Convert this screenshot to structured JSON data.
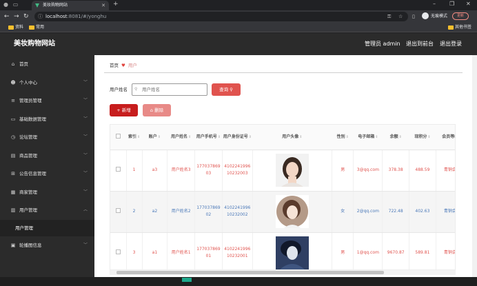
{
  "browser": {
    "tab_title": "美妆购物网站",
    "url_host": "localhost",
    "url_path": ":8081/#/yonghu",
    "incognito_label": "无痕模式",
    "update_label": "更新",
    "bookmarks": [
      "资料",
      "常用"
    ],
    "other_bookmarks": "其他书签"
  },
  "header": {
    "brand": "美妆购物网站",
    "admin": "管理员 admin",
    "back": "退出到前台",
    "logout": "退出登录"
  },
  "sidebar": {
    "items": [
      {
        "label": "首页",
        "icon": "home-icon",
        "glyph": "⌂",
        "expandable": false
      },
      {
        "label": "个人中心",
        "icon": "user-icon",
        "glyph": "☻",
        "expandable": true
      },
      {
        "label": "管理员管理",
        "icon": "sliders-icon",
        "glyph": "≡",
        "expandable": true
      },
      {
        "label": "基础数据管理",
        "icon": "monitor-icon",
        "glyph": "▭",
        "expandable": true
      },
      {
        "label": "论坛管理",
        "icon": "clock-icon",
        "glyph": "◷",
        "expandable": true
      },
      {
        "label": "商品管理",
        "icon": "box-icon",
        "glyph": "▤",
        "expandable": true
      },
      {
        "label": "公告信息管理",
        "icon": "grid-icon",
        "glyph": "⊞",
        "expandable": true
      },
      {
        "label": "商家管理",
        "icon": "chart-icon",
        "glyph": "▦",
        "expandable": true
      },
      {
        "label": "用户管理",
        "icon": "doc-icon",
        "glyph": "▥",
        "expandable": true,
        "open": true
      },
      {
        "label": "轮播图信息",
        "icon": "image-icon",
        "glyph": "▣",
        "expandable": true
      }
    ],
    "sub_item": "用户管理"
  },
  "breadcrumb": {
    "home": "首页",
    "current": "用户"
  },
  "search": {
    "label": "用户姓名",
    "placeholder": "用户姓名",
    "button": "查询"
  },
  "actions": {
    "add": "+ 新增",
    "delete": "删除"
  },
  "table": {
    "columns": [
      "索引",
      "账户",
      "用户姓名",
      "用户手机号",
      "用户身份证号",
      "用户头像",
      "性别",
      "电子邮箱",
      "余额",
      "现积分",
      "会员等级"
    ],
    "rows": [
      {
        "index": "1",
        "account": "a3",
        "name": "用户姓名3",
        "phone": "17703786903",
        "idcard": "410224199610232003",
        "avatar": "avatar-3",
        "gender": "男",
        "email": "3@qq.com",
        "balance": "378.38",
        "points": "488.59",
        "level": "青铜会员"
      },
      {
        "index": "2",
        "account": "a2",
        "name": "用户姓名2",
        "phone": "17703786902",
        "idcard": "410224199610232002",
        "avatar": "avatar-2",
        "gender": "女",
        "email": "2@qq.com",
        "balance": "722.48",
        "points": "402.63",
        "level": "青铜会员"
      },
      {
        "index": "3",
        "account": "a1",
        "name": "用户姓名1",
        "phone": "17703786901",
        "idcard": "410224199610232001",
        "avatar": "avatar-1",
        "gender": "男",
        "email": "1@qq.com",
        "balance": "9670.87",
        "points": "589.81",
        "level": "青铜会员"
      }
    ]
  },
  "colors": {
    "accent": "#e0534e",
    "sidebar_bg": "#2b2b2b",
    "link_blue": "#4a78b8"
  }
}
